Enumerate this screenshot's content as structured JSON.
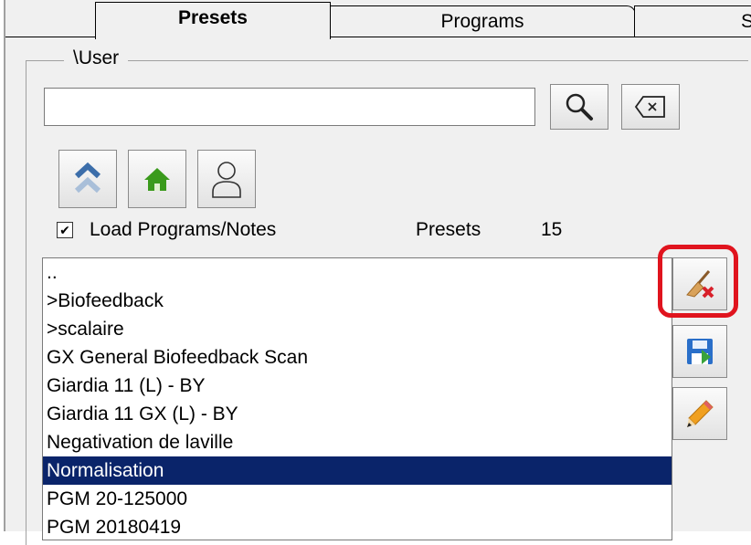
{
  "tabs": [
    {
      "label": "Presets",
      "active": true
    },
    {
      "label": "Programs",
      "active": false
    },
    {
      "label": "S",
      "active": false
    }
  ],
  "group": {
    "label": "\\User"
  },
  "search": {
    "value": "",
    "placeholder": ""
  },
  "nav_buttons": {
    "up_icon": "double-chevron-up-icon",
    "home_icon": "home-icon",
    "user_icon": "user-icon"
  },
  "options": {
    "load_label": "Load Programs/Notes",
    "load_checked": true,
    "check_mark": "✔",
    "presets_label": "Presets",
    "presets_count": "15"
  },
  "list": {
    "items": [
      "..",
      ">Biofeedback",
      ">scalaire",
      "GX General Biofeedback Scan",
      "Giardia 11 (L) - BY",
      "Giardia 11 GX (L) - BY",
      "Negativation de laville",
      "Normalisation",
      "PGM 20-125000",
      "PGM 20180419"
    ],
    "selected_index": 7
  },
  "side_buttons": {
    "clear_icon": "broom-delete-icon",
    "save_icon": "save-icon",
    "edit_icon": "pencil-icon"
  },
  "colors": {
    "selection": "#0a246a",
    "highlight": "#e0141e",
    "home_green": "#3a9a1c"
  }
}
